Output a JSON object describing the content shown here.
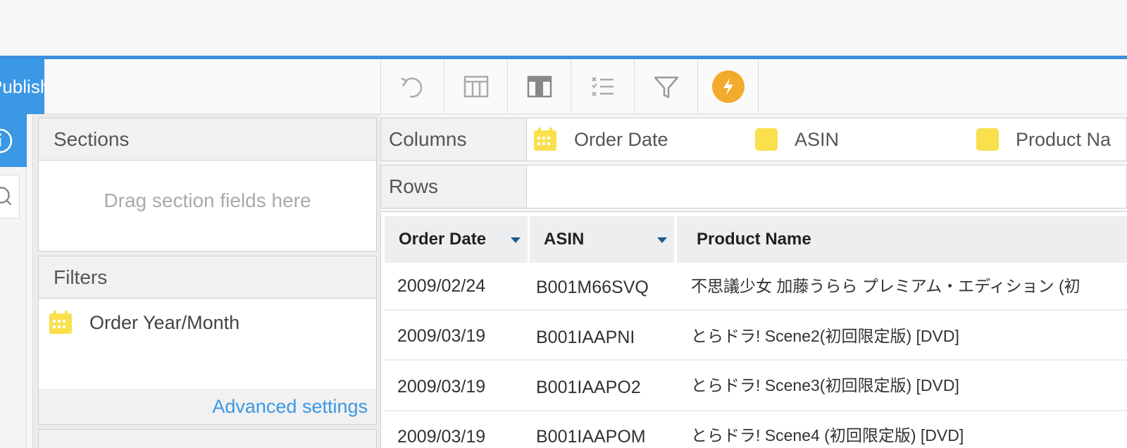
{
  "toolbar": {
    "publish_label": "Publish",
    "tools": [
      "undo-icon",
      "table-icon",
      "column-table-icon",
      "checklist-icon",
      "filter-icon",
      "lightning-icon"
    ]
  },
  "panels": {
    "sections_title": "Sections",
    "sections_hint": "Drag section fields here",
    "filters_title": "Filters",
    "filter_items": [
      "Order Year/Month"
    ],
    "advanced_settings": "Advanced settings"
  },
  "shelves": {
    "columns_label": "Columns",
    "rows_label": "Rows",
    "columns": [
      "Order Date",
      "ASIN",
      "Product Na"
    ]
  },
  "table": {
    "headers": [
      "Order Date",
      "ASIN",
      "Product Name"
    ],
    "rows": [
      [
        "2009/02/24",
        "B001M66SVQ",
        "不思議少女 加藤うらら プレミアム・エディション (初"
      ],
      [
        "2009/03/19",
        "B001IAAPNI",
        "とらドラ! Scene2(初回限定版) [DVD]"
      ],
      [
        "2009/03/19",
        "B001IAAPO2",
        "とらドラ! Scene3(初回限定版) [DVD]"
      ],
      [
        "2009/03/19",
        "B001IAAPOM",
        "とらドラ! Scene4 (初回限定版) [DVD]"
      ]
    ]
  },
  "colors": {
    "accent": "#3a98e4",
    "field_yellow": "#f9e04c",
    "lightning_orange": "#f2ab2c"
  }
}
